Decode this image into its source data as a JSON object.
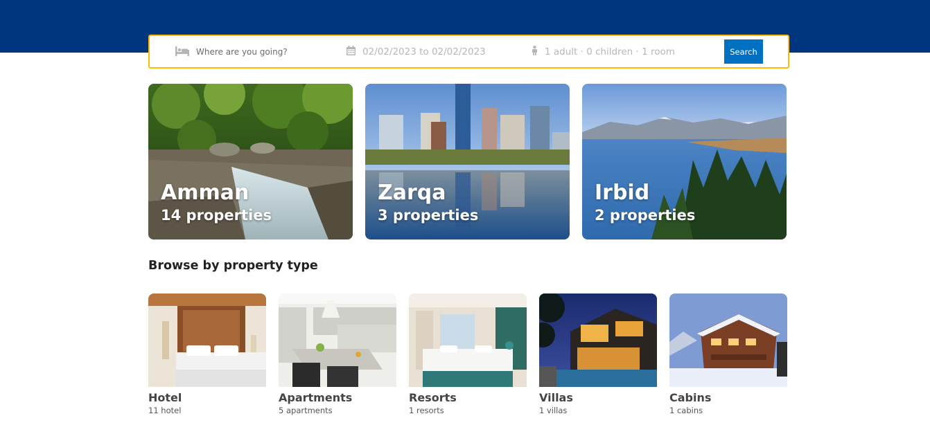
{
  "search": {
    "destination_placeholder": "Where are you going?",
    "dates": "02/02/2023 to 02/02/2023",
    "guests": "1 adult · 0 children · 1 room",
    "button_label": "Search"
  },
  "featured": [
    {
      "name": "Amman",
      "count": "14 properties"
    },
    {
      "name": "Zarqa",
      "count": "3 properties"
    },
    {
      "name": "Irbid",
      "count": "2 properties"
    }
  ],
  "property_section_title": "Browse by property type",
  "property_types": [
    {
      "title": "Hotel",
      "count": "11 hotel"
    },
    {
      "title": "Apartments",
      "count": "5 apartments"
    },
    {
      "title": "Resorts",
      "count": "1 resorts"
    },
    {
      "title": "Villas",
      "count": "1 villas"
    },
    {
      "title": "Cabins",
      "count": "1 cabins"
    }
  ],
  "colors": {
    "header_bg": "#003580",
    "search_border": "#febb02",
    "search_button": "#0071c2"
  },
  "icons": {
    "destination": "bed-icon",
    "dates": "calendar-icon",
    "guests": "person-icon"
  }
}
